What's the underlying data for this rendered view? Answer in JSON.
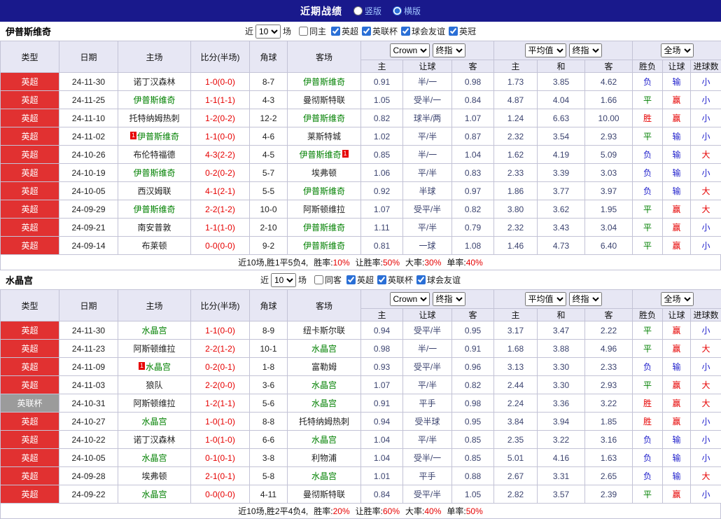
{
  "topbar": {
    "title": "近期战绩",
    "radio_vertical": "竖版",
    "radio_horizontal": "横版"
  },
  "misc": {
    "card_badge": "1"
  },
  "colors": {
    "topbar_bg": "#19198c",
    "accent_blue": "#2a6fd6",
    "league_red": "#e13131",
    "league_gray": "#9b9b9b",
    "focus_team_green": "#008000",
    "score_red": "#e60000",
    "win_red": "#e60000",
    "draw_green": "#008000",
    "lose_blue": "#2222cc",
    "odds_navy": "#3c4470"
  },
  "result_class_map": {
    "胜": "r",
    "平": "g",
    "负": "b",
    "赢": "r",
    "输": "b",
    "大": "r",
    "小": "b"
  },
  "sections": [
    {
      "team": "伊普斯维奇",
      "filter": {
        "near_label": "近",
        "count": "10",
        "games_label": "场",
        "same_label": "同主",
        "leagues": [
          "英超",
          "英联杯",
          "球会友谊",
          "英冠"
        ]
      },
      "header": {
        "col_type": "类型",
        "col_date": "日期",
        "col_home": "主场",
        "col_score": "比分(半场)",
        "col_corner": "角球",
        "col_away": "客场",
        "crow_select": "Crown",
        "final_select": "终指",
        "avg_select": "平均值",
        "final_select2": "终指",
        "full_select": "全场",
        "sub": [
          "主",
          "让球",
          "客",
          "主",
          "和",
          "客",
          "胜负",
          "让球",
          "进球数"
        ]
      },
      "rows": [
        {
          "league": "英超",
          "style": "red",
          "date": "24-11-30",
          "home": "诺丁汉森林",
          "home_focus": false,
          "home_card": "",
          "score": "1-0(0-0)",
          "corner": "8-7",
          "away": "伊普斯维奇",
          "away_focus": true,
          "away_card": "",
          "o1": "0.91",
          "h": "半/一",
          "o2": "0.98",
          "a1": "1.73",
          "a2": "3.85",
          "a3": "4.62",
          "res": "负",
          "hcp": "输",
          "size": "小"
        },
        {
          "league": "英超",
          "style": "red",
          "date": "24-11-25",
          "home": "伊普斯维奇",
          "home_focus": true,
          "home_card": "",
          "score": "1-1(1-1)",
          "corner": "4-3",
          "away": "曼彻斯特联",
          "away_focus": false,
          "away_card": "",
          "o1": "1.05",
          "h": "受半/一",
          "o2": "0.84",
          "a1": "4.87",
          "a2": "4.04",
          "a3": "1.66",
          "res": "平",
          "hcp": "赢",
          "size": "小"
        },
        {
          "league": "英超",
          "style": "red",
          "date": "24-11-10",
          "home": "托特纳姆热刺",
          "home_focus": false,
          "home_card": "",
          "score": "1-2(0-2)",
          "corner": "12-2",
          "away": "伊普斯维奇",
          "away_focus": true,
          "away_card": "",
          "o1": "0.82",
          "h": "球半/两",
          "o2": "1.07",
          "a1": "1.24",
          "a2": "6.63",
          "a3": "10.00",
          "res": "胜",
          "hcp": "赢",
          "size": "小"
        },
        {
          "league": "英超",
          "style": "red",
          "date": "24-11-02",
          "home": "伊普斯维奇",
          "home_focus": true,
          "home_card": "pre",
          "score": "1-1(0-0)",
          "corner": "4-6",
          "away": "莱斯特城",
          "away_focus": false,
          "away_card": "",
          "o1": "1.02",
          "h": "平/半",
          "o2": "0.87",
          "a1": "2.32",
          "a2": "3.54",
          "a3": "2.93",
          "res": "平",
          "hcp": "输",
          "size": "小"
        },
        {
          "league": "英超",
          "style": "red",
          "date": "24-10-26",
          "home": "布伦特福德",
          "home_focus": false,
          "home_card": "",
          "score": "4-3(2-2)",
          "corner": "4-5",
          "away": "伊普斯维奇",
          "away_focus": true,
          "away_card": "post",
          "o1": "0.85",
          "h": "半/一",
          "o2": "1.04",
          "a1": "1.62",
          "a2": "4.19",
          "a3": "5.09",
          "res": "负",
          "hcp": "输",
          "size": "大"
        },
        {
          "league": "英超",
          "style": "red",
          "date": "24-10-19",
          "home": "伊普斯维奇",
          "home_focus": true,
          "home_card": "",
          "score": "0-2(0-2)",
          "corner": "5-7",
          "away": "埃弗顿",
          "away_focus": false,
          "away_card": "",
          "o1": "1.06",
          "h": "平/半",
          "o2": "0.83",
          "a1": "2.33",
          "a2": "3.39",
          "a3": "3.03",
          "res": "负",
          "hcp": "输",
          "size": "小"
        },
        {
          "league": "英超",
          "style": "red",
          "date": "24-10-05",
          "home": "西汉姆联",
          "home_focus": false,
          "home_card": "",
          "score": "4-1(2-1)",
          "corner": "5-5",
          "away": "伊普斯维奇",
          "away_focus": true,
          "away_card": "",
          "o1": "0.92",
          "h": "半球",
          "o2": "0.97",
          "a1": "1.86",
          "a2": "3.77",
          "a3": "3.97",
          "res": "负",
          "hcp": "输",
          "size": "大"
        },
        {
          "league": "英超",
          "style": "red",
          "date": "24-09-29",
          "home": "伊普斯维奇",
          "home_focus": true,
          "home_card": "",
          "score": "2-2(1-2)",
          "corner": "10-0",
          "away": "阿斯顿维拉",
          "away_focus": false,
          "away_card": "",
          "o1": "1.07",
          "h": "受平/半",
          "o2": "0.82",
          "a1": "3.80",
          "a2": "3.62",
          "a3": "1.95",
          "res": "平",
          "hcp": "赢",
          "size": "大"
        },
        {
          "league": "英超",
          "style": "red",
          "date": "24-09-21",
          "home": "南安普敦",
          "home_focus": false,
          "home_card": "",
          "score": "1-1(1-0)",
          "corner": "2-10",
          "away": "伊普斯维奇",
          "away_focus": true,
          "away_card": "",
          "o1": "1.11",
          "h": "平/半",
          "o2": "0.79",
          "a1": "2.32",
          "a2": "3.43",
          "a3": "3.04",
          "res": "平",
          "hcp": "赢",
          "size": "小"
        },
        {
          "league": "英超",
          "style": "red",
          "date": "24-09-14",
          "home": "布莱顿",
          "home_focus": false,
          "home_card": "",
          "score": "0-0(0-0)",
          "corner": "9-2",
          "away": "伊普斯维奇",
          "away_focus": true,
          "away_card": "",
          "o1": "0.81",
          "h": "一球",
          "o2": "1.08",
          "a1": "1.46",
          "a2": "4.73",
          "a3": "6.40",
          "res": "平",
          "hcp": "赢",
          "size": "小"
        }
      ],
      "summary": {
        "prefix": "近10场,胜1平5负4,",
        "stats": [
          {
            "label": "胜率:",
            "value": "10%"
          },
          {
            "label": "让胜率:",
            "value": "50%"
          },
          {
            "label": "大率:",
            "value": "30%"
          },
          {
            "label": "单率:",
            "value": "40%"
          }
        ]
      }
    },
    {
      "team": "水晶宫",
      "filter": {
        "near_label": "近",
        "count": "10",
        "games_label": "场",
        "same_label": "同客",
        "leagues": [
          "英超",
          "英联杯",
          "球会友谊"
        ]
      },
      "header": {
        "col_type": "类型",
        "col_date": "日期",
        "col_home": "主场",
        "col_score": "比分(半场)",
        "col_corner": "角球",
        "col_away": "客场",
        "crow_select": "Crown",
        "final_select": "终指",
        "avg_select": "平均值",
        "final_select2": "终指",
        "full_select": "全场",
        "sub": [
          "主",
          "让球",
          "客",
          "主",
          "和",
          "客",
          "胜负",
          "让球",
          "进球数"
        ]
      },
      "rows": [
        {
          "league": "英超",
          "style": "red",
          "date": "24-11-30",
          "home": "水晶宫",
          "home_focus": true,
          "home_card": "",
          "score": "1-1(0-0)",
          "corner": "8-9",
          "away": "纽卡斯尔联",
          "away_focus": false,
          "away_card": "",
          "o1": "0.94",
          "h": "受平/半",
          "o2": "0.95",
          "a1": "3.17",
          "a2": "3.47",
          "a3": "2.22",
          "res": "平",
          "hcp": "赢",
          "size": "小"
        },
        {
          "league": "英超",
          "style": "red",
          "date": "24-11-23",
          "home": "阿斯顿维拉",
          "home_focus": false,
          "home_card": "",
          "score": "2-2(1-2)",
          "corner": "10-1",
          "away": "水晶宫",
          "away_focus": true,
          "away_card": "",
          "o1": "0.98",
          "h": "半/一",
          "o2": "0.91",
          "a1": "1.68",
          "a2": "3.88",
          "a3": "4.96",
          "res": "平",
          "hcp": "赢",
          "size": "大"
        },
        {
          "league": "英超",
          "style": "red",
          "date": "24-11-09",
          "home": "水晶宫",
          "home_focus": true,
          "home_card": "pre",
          "score": "0-2(0-1)",
          "corner": "1-8",
          "away": "富勒姆",
          "away_focus": false,
          "away_card": "",
          "o1": "0.93",
          "h": "受平/半",
          "o2": "0.96",
          "a1": "3.13",
          "a2": "3.30",
          "a3": "2.33",
          "res": "负",
          "hcp": "输",
          "size": "小"
        },
        {
          "league": "英超",
          "style": "red",
          "date": "24-11-03",
          "home": "狼队",
          "home_focus": false,
          "home_card": "",
          "score": "2-2(0-0)",
          "corner": "3-6",
          "away": "水晶宫",
          "away_focus": true,
          "away_card": "",
          "o1": "1.07",
          "h": "平/半",
          "o2": "0.82",
          "a1": "2.44",
          "a2": "3.30",
          "a3": "2.93",
          "res": "平",
          "hcp": "赢",
          "size": "大"
        },
        {
          "league": "英联杯",
          "style": "gray",
          "date": "24-10-31",
          "home": "阿斯顿维拉",
          "home_focus": false,
          "home_card": "",
          "score": "1-2(1-1)",
          "corner": "5-6",
          "away": "水晶宫",
          "away_focus": true,
          "away_card": "",
          "o1": "0.91",
          "h": "平手",
          "o2": "0.98",
          "a1": "2.24",
          "a2": "3.36",
          "a3": "3.22",
          "res": "胜",
          "hcp": "赢",
          "size": "大"
        },
        {
          "league": "英超",
          "style": "red",
          "date": "24-10-27",
          "home": "水晶宫",
          "home_focus": true,
          "home_card": "",
          "score": "1-0(1-0)",
          "corner": "8-8",
          "away": "托特纳姆热刺",
          "away_focus": false,
          "away_card": "",
          "o1": "0.94",
          "h": "受半球",
          "o2": "0.95",
          "a1": "3.84",
          "a2": "3.94",
          "a3": "1.85",
          "res": "胜",
          "hcp": "赢",
          "size": "小"
        },
        {
          "league": "英超",
          "style": "red",
          "date": "24-10-22",
          "home": "诺丁汉森林",
          "home_focus": false,
          "home_card": "",
          "score": "1-0(1-0)",
          "corner": "6-6",
          "away": "水晶宫",
          "away_focus": true,
          "away_card": "",
          "o1": "1.04",
          "h": "平/半",
          "o2": "0.85",
          "a1": "2.35",
          "a2": "3.22",
          "a3": "3.16",
          "res": "负",
          "hcp": "输",
          "size": "小"
        },
        {
          "league": "英超",
          "style": "red",
          "date": "24-10-05",
          "home": "水晶宫",
          "home_focus": true,
          "home_card": "",
          "score": "0-1(0-1)",
          "corner": "3-8",
          "away": "利物浦",
          "away_focus": false,
          "away_card": "",
          "o1": "1.04",
          "h": "受半/一",
          "o2": "0.85",
          "a1": "5.01",
          "a2": "4.16",
          "a3": "1.63",
          "res": "负",
          "hcp": "输",
          "size": "小"
        },
        {
          "league": "英超",
          "style": "red",
          "date": "24-09-28",
          "home": "埃弗顿",
          "home_focus": false,
          "home_card": "",
          "score": "2-1(0-1)",
          "corner": "5-8",
          "away": "水晶宫",
          "away_focus": true,
          "away_card": "",
          "o1": "1.01",
          "h": "平手",
          "o2": "0.88",
          "a1": "2.67",
          "a2": "3.31",
          "a3": "2.65",
          "res": "负",
          "hcp": "输",
          "size": "大"
        },
        {
          "league": "英超",
          "style": "red",
          "date": "24-09-22",
          "home": "水晶宫",
          "home_focus": true,
          "home_card": "",
          "score": "0-0(0-0)",
          "corner": "4-11",
          "away": "曼彻斯特联",
          "away_focus": false,
          "away_card": "",
          "o1": "0.84",
          "h": "受平/半",
          "o2": "1.05",
          "a1": "2.82",
          "a2": "3.57",
          "a3": "2.39",
          "res": "平",
          "hcp": "赢",
          "size": "小"
        }
      ],
      "summary": {
        "prefix": "近10场,胜2平4负4,",
        "stats": [
          {
            "label": "胜率:",
            "value": "20%"
          },
          {
            "label": "让胜率:",
            "value": "60%"
          },
          {
            "label": "大率:",
            "value": "40%"
          },
          {
            "label": "单率:",
            "value": "50%"
          }
        ]
      }
    }
  ]
}
